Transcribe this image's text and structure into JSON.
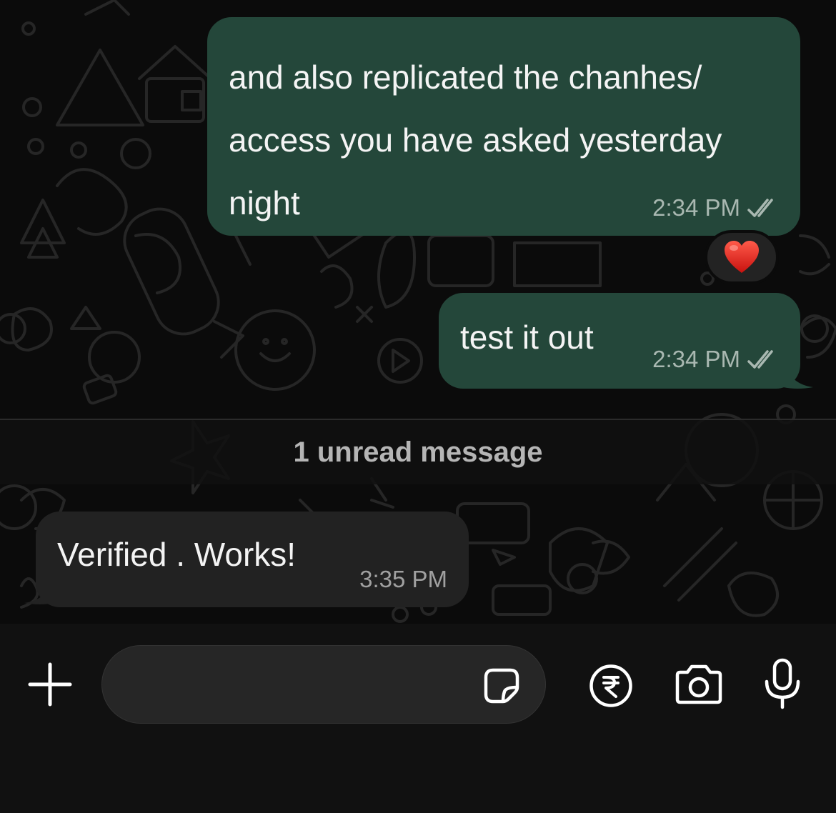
{
  "messages": [
    {
      "direction": "outgoing",
      "lines": [
        "and also replicated the chanhes/",
        "access you have asked yesterday",
        "night"
      ],
      "time": "2:34 PM",
      "status": "read",
      "reaction": "❤️"
    },
    {
      "direction": "outgoing",
      "lines": [
        "test it out"
      ],
      "time": "2:34 PM",
      "status": "read"
    },
    {
      "direction": "incoming",
      "lines": [
        "Verified . Works!"
      ],
      "time": "3:35 PM"
    }
  ],
  "unread_banner": "1 unread message",
  "composer": {
    "placeholder": "",
    "icons": [
      "plus-icon",
      "sticker-icon",
      "rupee-payment-icon",
      "camera-icon",
      "microphone-icon"
    ]
  },
  "colors": {
    "outgoing_bubble": "#24473a",
    "incoming_bubble": "#222222",
    "background": "#0b0b0b",
    "read_ticks": "#a9b8b1"
  }
}
